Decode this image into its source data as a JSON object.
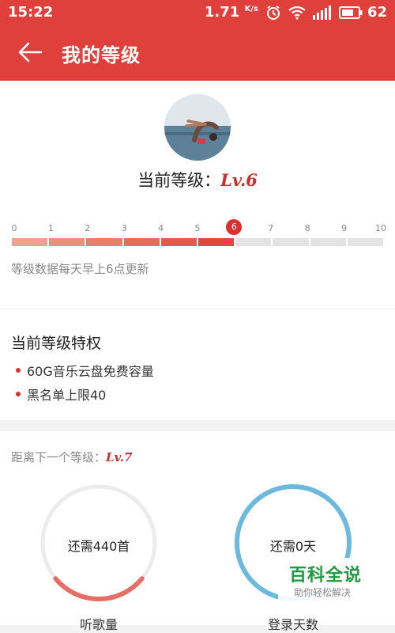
{
  "status_bar": {
    "time": "15:22",
    "speed": "1.71",
    "speed_unit": "K/s",
    "battery": "62",
    "icons": [
      "alarm-icon",
      "wifi-icon",
      "signal-icon",
      "battery-icon"
    ]
  },
  "app_bar": {
    "title": "我的等级",
    "back_icon": "arrow-left-icon",
    "color": "#e0403c"
  },
  "level": {
    "label": "当前等级：",
    "value": "Lv.6",
    "current": 6,
    "ticks": [
      "0",
      "1",
      "2",
      "3",
      "4",
      "5",
      "6",
      "7",
      "8",
      "9",
      "10"
    ],
    "update_note": "等级数据每天早上6点更新"
  },
  "privileges": {
    "title": "当前等级特权",
    "items": [
      "60G音乐云盘免费容量",
      "黑名单上限40"
    ]
  },
  "next_level": {
    "label": "距离下一个等级：",
    "value": "Lv.7",
    "rings": [
      {
        "text": "还需440首",
        "caption": "听歌量",
        "progress": 0.28,
        "color": "#e56f66"
      },
      {
        "text": "还需0天",
        "caption": "登录天数",
        "progress": 1.0,
        "color": "#6cb9de"
      }
    ]
  },
  "watermark": {
    "title": "百科全说",
    "subtitle": "助你轻松解决"
  }
}
